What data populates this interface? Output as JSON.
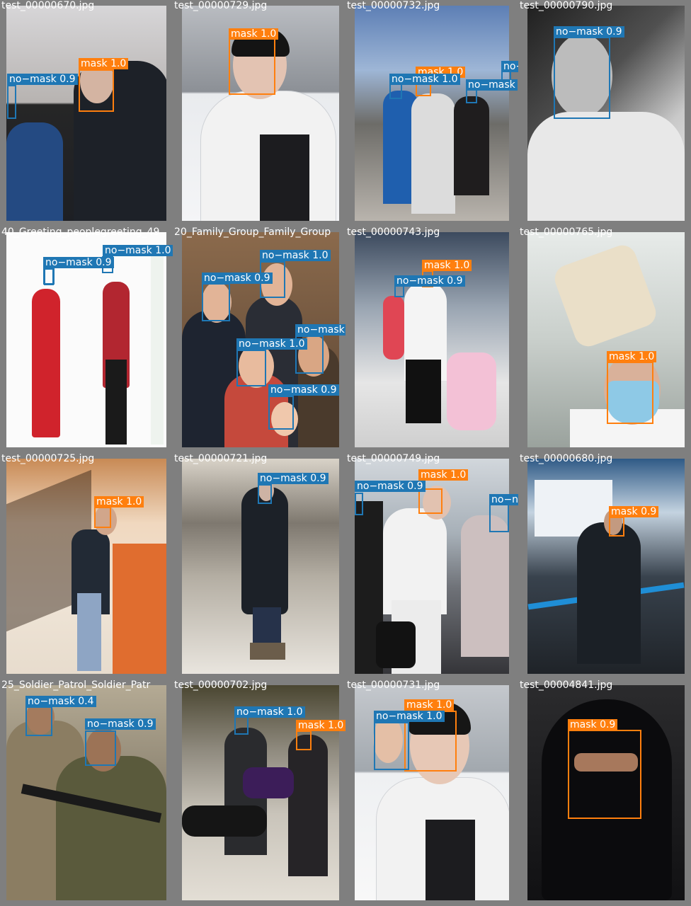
{
  "colors": {
    "mask": "#ff7f0e",
    "no_mask": "#1f77b4",
    "background": "#7f7f7f"
  },
  "cells": [
    {
      "filename": "test_00000670.jpg",
      "detections": [
        {
          "cls": "mask",
          "label": "mask 1.0"
        },
        {
          "cls": "no-mask",
          "label": "no−mask 0.9"
        }
      ]
    },
    {
      "filename": "test_00000729.jpg",
      "detections": [
        {
          "cls": "mask",
          "label": "mask 1.0"
        }
      ]
    },
    {
      "filename": "test_00000732.jpg",
      "detections": [
        {
          "cls": "mask",
          "label": "mask 1.0"
        },
        {
          "cls": "no-mask",
          "label": "no−mask 1.0"
        },
        {
          "cls": "no-mask",
          "label": "no−mask"
        },
        {
          "cls": "no-mask",
          "label": "no−"
        }
      ]
    },
    {
      "filename": "test_00000790.jpg",
      "detections": [
        {
          "cls": "no-mask",
          "label": "no−mask 0.9"
        }
      ]
    },
    {
      "filename": "40_Greeting_peoplegreeting_49",
      "detections": [
        {
          "cls": "no-mask",
          "label": "no−mask 1.0"
        },
        {
          "cls": "no-mask",
          "label": "no−mask 0.9"
        }
      ]
    },
    {
      "filename": "20_Family_Group_Family_Group",
      "detections": [
        {
          "cls": "no-mask",
          "label": "no−mask 1.0"
        },
        {
          "cls": "no-mask",
          "label": "no−mask 0.9"
        },
        {
          "cls": "no-mask",
          "label": "no−mask"
        },
        {
          "cls": "no-mask",
          "label": "no−mask 1.0"
        },
        {
          "cls": "no-mask",
          "label": "no−mask 0.9"
        }
      ]
    },
    {
      "filename": "test_00000743.jpg",
      "detections": [
        {
          "cls": "mask",
          "label": "mask 1.0"
        },
        {
          "cls": "no-mask",
          "label": "no−mask 0.9"
        }
      ]
    },
    {
      "filename": "test_00000765.jpg",
      "detections": [
        {
          "cls": "mask",
          "label": "mask 1.0"
        }
      ]
    },
    {
      "filename": "test_00000725.jpg",
      "detections": [
        {
          "cls": "mask",
          "label": "mask 1.0"
        }
      ]
    },
    {
      "filename": "test_00000721.jpg",
      "detections": [
        {
          "cls": "no-mask",
          "label": "no−mask 0.9"
        }
      ]
    },
    {
      "filename": "test_00000749.jpg",
      "detections": [
        {
          "cls": "mask",
          "label": "mask 1.0"
        },
        {
          "cls": "no-mask",
          "label": "no−mask 0.9"
        },
        {
          "cls": "no-mask",
          "label": "no−n"
        }
      ]
    },
    {
      "filename": "test_00000680.jpg",
      "detections": [
        {
          "cls": "mask",
          "label": "mask 0.9"
        }
      ]
    },
    {
      "filename": "25_Soldier_Patrol_Soldier_Patr",
      "detections": [
        {
          "cls": "no-mask",
          "label": "no−mask 0.4"
        },
        {
          "cls": "no-mask",
          "label": "no−mask 0.9"
        }
      ]
    },
    {
      "filename": "test_00000702.jpg",
      "detections": [
        {
          "cls": "no-mask",
          "label": "no−mask 1.0"
        },
        {
          "cls": "mask",
          "label": "mask 1.0"
        }
      ]
    },
    {
      "filename": "test_00000731.jpg",
      "detections": [
        {
          "cls": "mask",
          "label": "mask 1.0"
        },
        {
          "cls": "no-mask",
          "label": "no−mask 1.0"
        }
      ]
    },
    {
      "filename": "test_00004841.jpg",
      "detections": [
        {
          "cls": "mask",
          "label": "mask 0.9"
        }
      ]
    }
  ]
}
